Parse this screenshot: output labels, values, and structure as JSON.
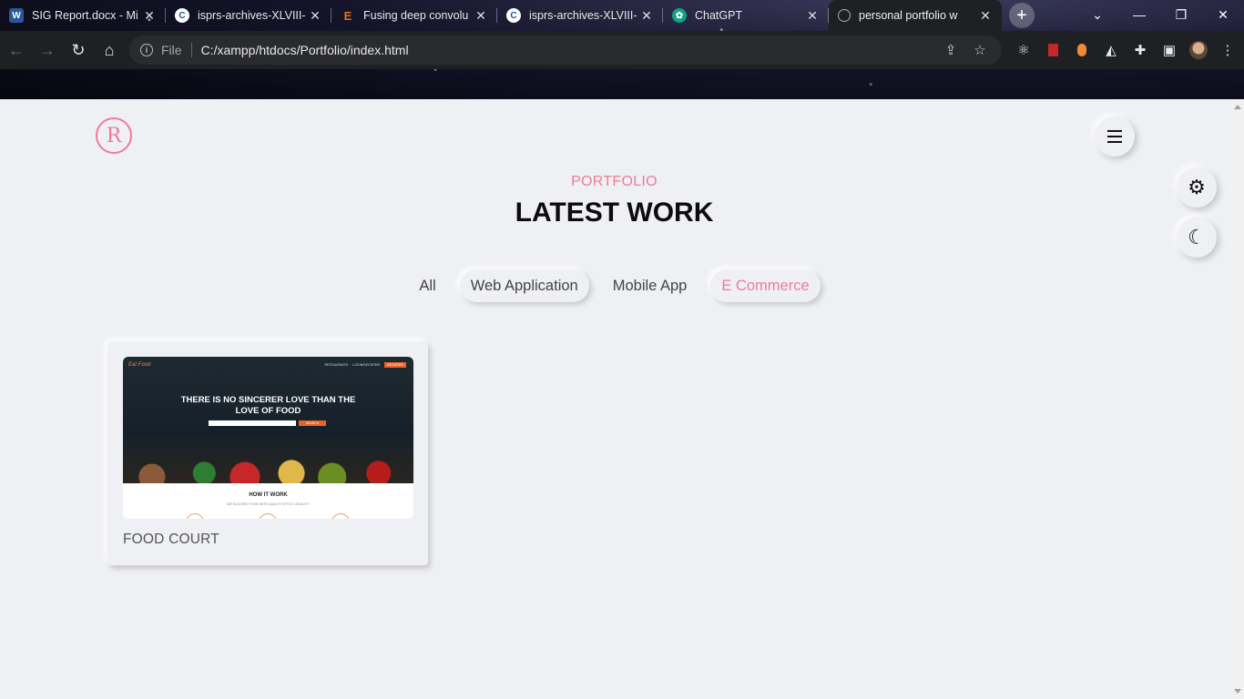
{
  "browser": {
    "tabs": [
      {
        "title": "SIG Report.docx - Mi",
        "icon": "word-icon",
        "color": "#2b579a"
      },
      {
        "title": "isprs-archives-XLVIII-",
        "icon": "copernicus-icon",
        "color": "#1a5aa8"
      },
      {
        "title": "Fusing deep convolu",
        "icon": "elsevier-icon",
        "color": "#e9711c"
      },
      {
        "title": "isprs-archives-XLVIII-",
        "icon": "copernicus-icon",
        "color": "#1a5aa8"
      },
      {
        "title": "ChatGPT",
        "icon": "chatgpt-icon",
        "color": "#10a37f"
      },
      {
        "title": "personal portfolio w",
        "icon": "globe-icon",
        "color": "#888888",
        "active": true
      }
    ],
    "new_tab_label": "+",
    "omnibox": {
      "scheme": "File",
      "url": "C:/xampp/htdocs/Portfolio/index.html"
    }
  },
  "page": {
    "logo_letter": "R",
    "accent_color": "#ee7b98",
    "section_subtitle": "PORTFOLIO",
    "section_title": "LATEST WORK",
    "filters": [
      {
        "label": "All",
        "style": "plain"
      },
      {
        "label": "Web Application",
        "style": "raised"
      },
      {
        "label": "Mobile App",
        "style": "plain"
      },
      {
        "label": "E Commerce",
        "style": "raised-accent"
      }
    ],
    "projects": [
      {
        "title": "FOOD COURT",
        "thumbnail": {
          "brand": "Eat Food",
          "nav": [
            "RESTAURANTS",
            "LOGIN/REGISTER"
          ],
          "nav_button": "REGISTER",
          "headline_line1": "THERE IS NO SINCERER LOVE THAN THE",
          "headline_line2": "LOVE OF FOOD",
          "search_button": "SEARCH",
          "how_title": "HOW IT WORK",
          "how_sub": "WE SUCCEED FOOD WITH QUALITY STYLE LOCALITY"
        }
      }
    ]
  }
}
